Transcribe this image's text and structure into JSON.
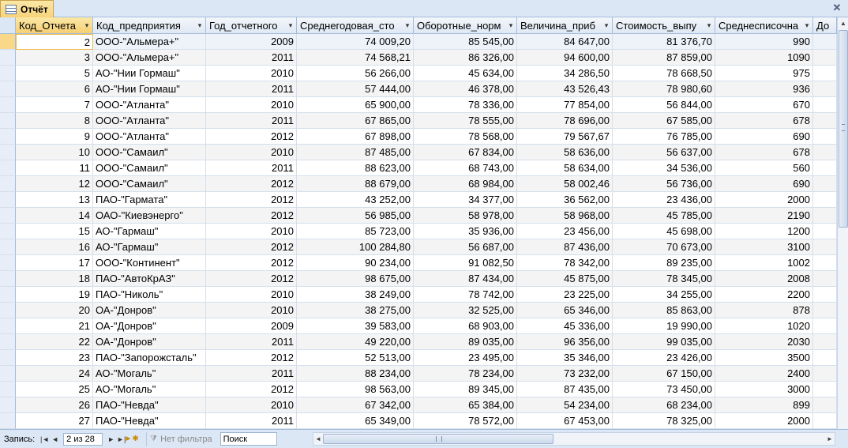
{
  "tab": {
    "title": "Отчёт",
    "close_glyph": "✕"
  },
  "columns": [
    {
      "label": "Код_Отчета",
      "align": "num"
    },
    {
      "label": "Код_предприятия",
      "align": "text"
    },
    {
      "label": "Год_отчетного",
      "align": "num"
    },
    {
      "label": "Среднегодовая_сто",
      "align": "num"
    },
    {
      "label": "Оборотные_норм",
      "align": "num"
    },
    {
      "label": "Величина_приб",
      "align": "num"
    },
    {
      "label": "Стоимость_выпу",
      "align": "num"
    },
    {
      "label": "Среднесписочна",
      "align": "num"
    },
    {
      "label": "До",
      "align": "text"
    }
  ],
  "rows": [
    [
      "2",
      "ООО-\"Альмера+\"",
      "2009",
      "74 009,20",
      "85 545,00",
      "84 647,00",
      "81 376,70",
      "990"
    ],
    [
      "3",
      "ООО-\"Альмера+\"",
      "2011",
      "74 568,21",
      "86 326,00",
      "94 600,00",
      "87 859,00",
      "1090"
    ],
    [
      "5",
      "АО-\"Нии Гормаш\"",
      "2010",
      "56 266,00",
      "45 634,00",
      "34 286,50",
      "78 668,50",
      "975"
    ],
    [
      "6",
      "АО-\"Нии Гормаш\"",
      "2011",
      "57 444,00",
      "46 378,00",
      "43 526,43",
      "78 980,60",
      "936"
    ],
    [
      "7",
      "ООО-\"Атланта\"",
      "2010",
      "65 900,00",
      "78 336,00",
      "77 854,00",
      "56 844,00",
      "670"
    ],
    [
      "8",
      "ООО-\"Атланта\"",
      "2011",
      "67 865,00",
      "78 555,00",
      "78 696,00",
      "67 585,00",
      "678"
    ],
    [
      "9",
      "ООО-\"Атланта\"",
      "2012",
      "67 898,00",
      "78 568,00",
      "79 567,67",
      "76 785,00",
      "690"
    ],
    [
      "10",
      "ООО-\"Самаил\"",
      "2010",
      "87 485,00",
      "67 834,00",
      "58 636,00",
      "56 637,00",
      "678"
    ],
    [
      "11",
      "ООО-\"Самаил\"",
      "2011",
      "88 623,00",
      "68 743,00",
      "58 634,00",
      "34 536,00",
      "560"
    ],
    [
      "12",
      "ООО-\"Самаил\"",
      "2012",
      "88 679,00",
      "68 984,00",
      "58 002,46",
      "56 736,00",
      "690"
    ],
    [
      "13",
      "ПАО-\"Гармата\"",
      "2012",
      "43 252,00",
      "34 377,00",
      "36 562,00",
      "23 436,00",
      "2000"
    ],
    [
      "14",
      "ОАО-\"Киевэнерго\"",
      "2012",
      "56 985,00",
      "58 978,00",
      "58 968,00",
      "45 785,00",
      "2190"
    ],
    [
      "15",
      "АО-\"Гармаш\"",
      "2010",
      "85 723,00",
      "35 936,00",
      "23 456,00",
      "45 698,00",
      "1200"
    ],
    [
      "16",
      "АО-\"Гармаш\"",
      "2012",
      "100 284,80",
      "56 687,00",
      "87 436,00",
      "70 673,00",
      "3100"
    ],
    [
      "17",
      "ООО-\"Континент\"",
      "2012",
      "90 234,00",
      "91 082,50",
      "78 342,00",
      "89 235,00",
      "1002"
    ],
    [
      "18",
      "ПАО-\"АвтоКрАЗ\"",
      "2012",
      "98 675,00",
      "87 434,00",
      "45 875,00",
      "78 345,00",
      "2008"
    ],
    [
      "19",
      "ПАО-\"Николь\"",
      "2010",
      "38 249,00",
      "78 742,00",
      "23 225,00",
      "34 255,00",
      "2200"
    ],
    [
      "20",
      "ОА-\"Донров\"",
      "2010",
      "38 275,00",
      "32 525,00",
      "65 346,00",
      "85 863,00",
      "878"
    ],
    [
      "21",
      "ОА-\"Донров\"",
      "2009",
      "39 583,00",
      "68 903,00",
      "45 336,00",
      "19 990,00",
      "1020"
    ],
    [
      "22",
      "ОА-\"Донров\"",
      "2011",
      "49 220,00",
      "89 035,00",
      "96 356,00",
      "99 035,00",
      "2030"
    ],
    [
      "23",
      "ПАО-\"Запорожсталь\"",
      "2012",
      "52 513,00",
      "23 495,00",
      "35 346,00",
      "23 426,00",
      "3500"
    ],
    [
      "24",
      "АО-\"Могаль\"",
      "2011",
      "88 234,00",
      "78 234,00",
      "73 232,00",
      "67 150,00",
      "2400"
    ],
    [
      "25",
      "АО-\"Могаль\"",
      "2012",
      "98 563,00",
      "89 345,00",
      "87 435,00",
      "73 450,00",
      "3000"
    ],
    [
      "26",
      "ПАО-\"Невда\"",
      "2010",
      "67 342,00",
      "65 384,00",
      "54 234,00",
      "68 234,00",
      "899"
    ],
    [
      "27",
      "ПАО-\"Невда\"",
      "2011",
      "65 349,00",
      "78 572,00",
      "67 453,00",
      "78 325,00",
      "2000"
    ]
  ],
  "selected_row": 0,
  "navbar": {
    "record_label": "Запись:",
    "record_value": "2 из 28",
    "no_filter_label": "Нет фильтра",
    "search_value": "Поиск"
  }
}
